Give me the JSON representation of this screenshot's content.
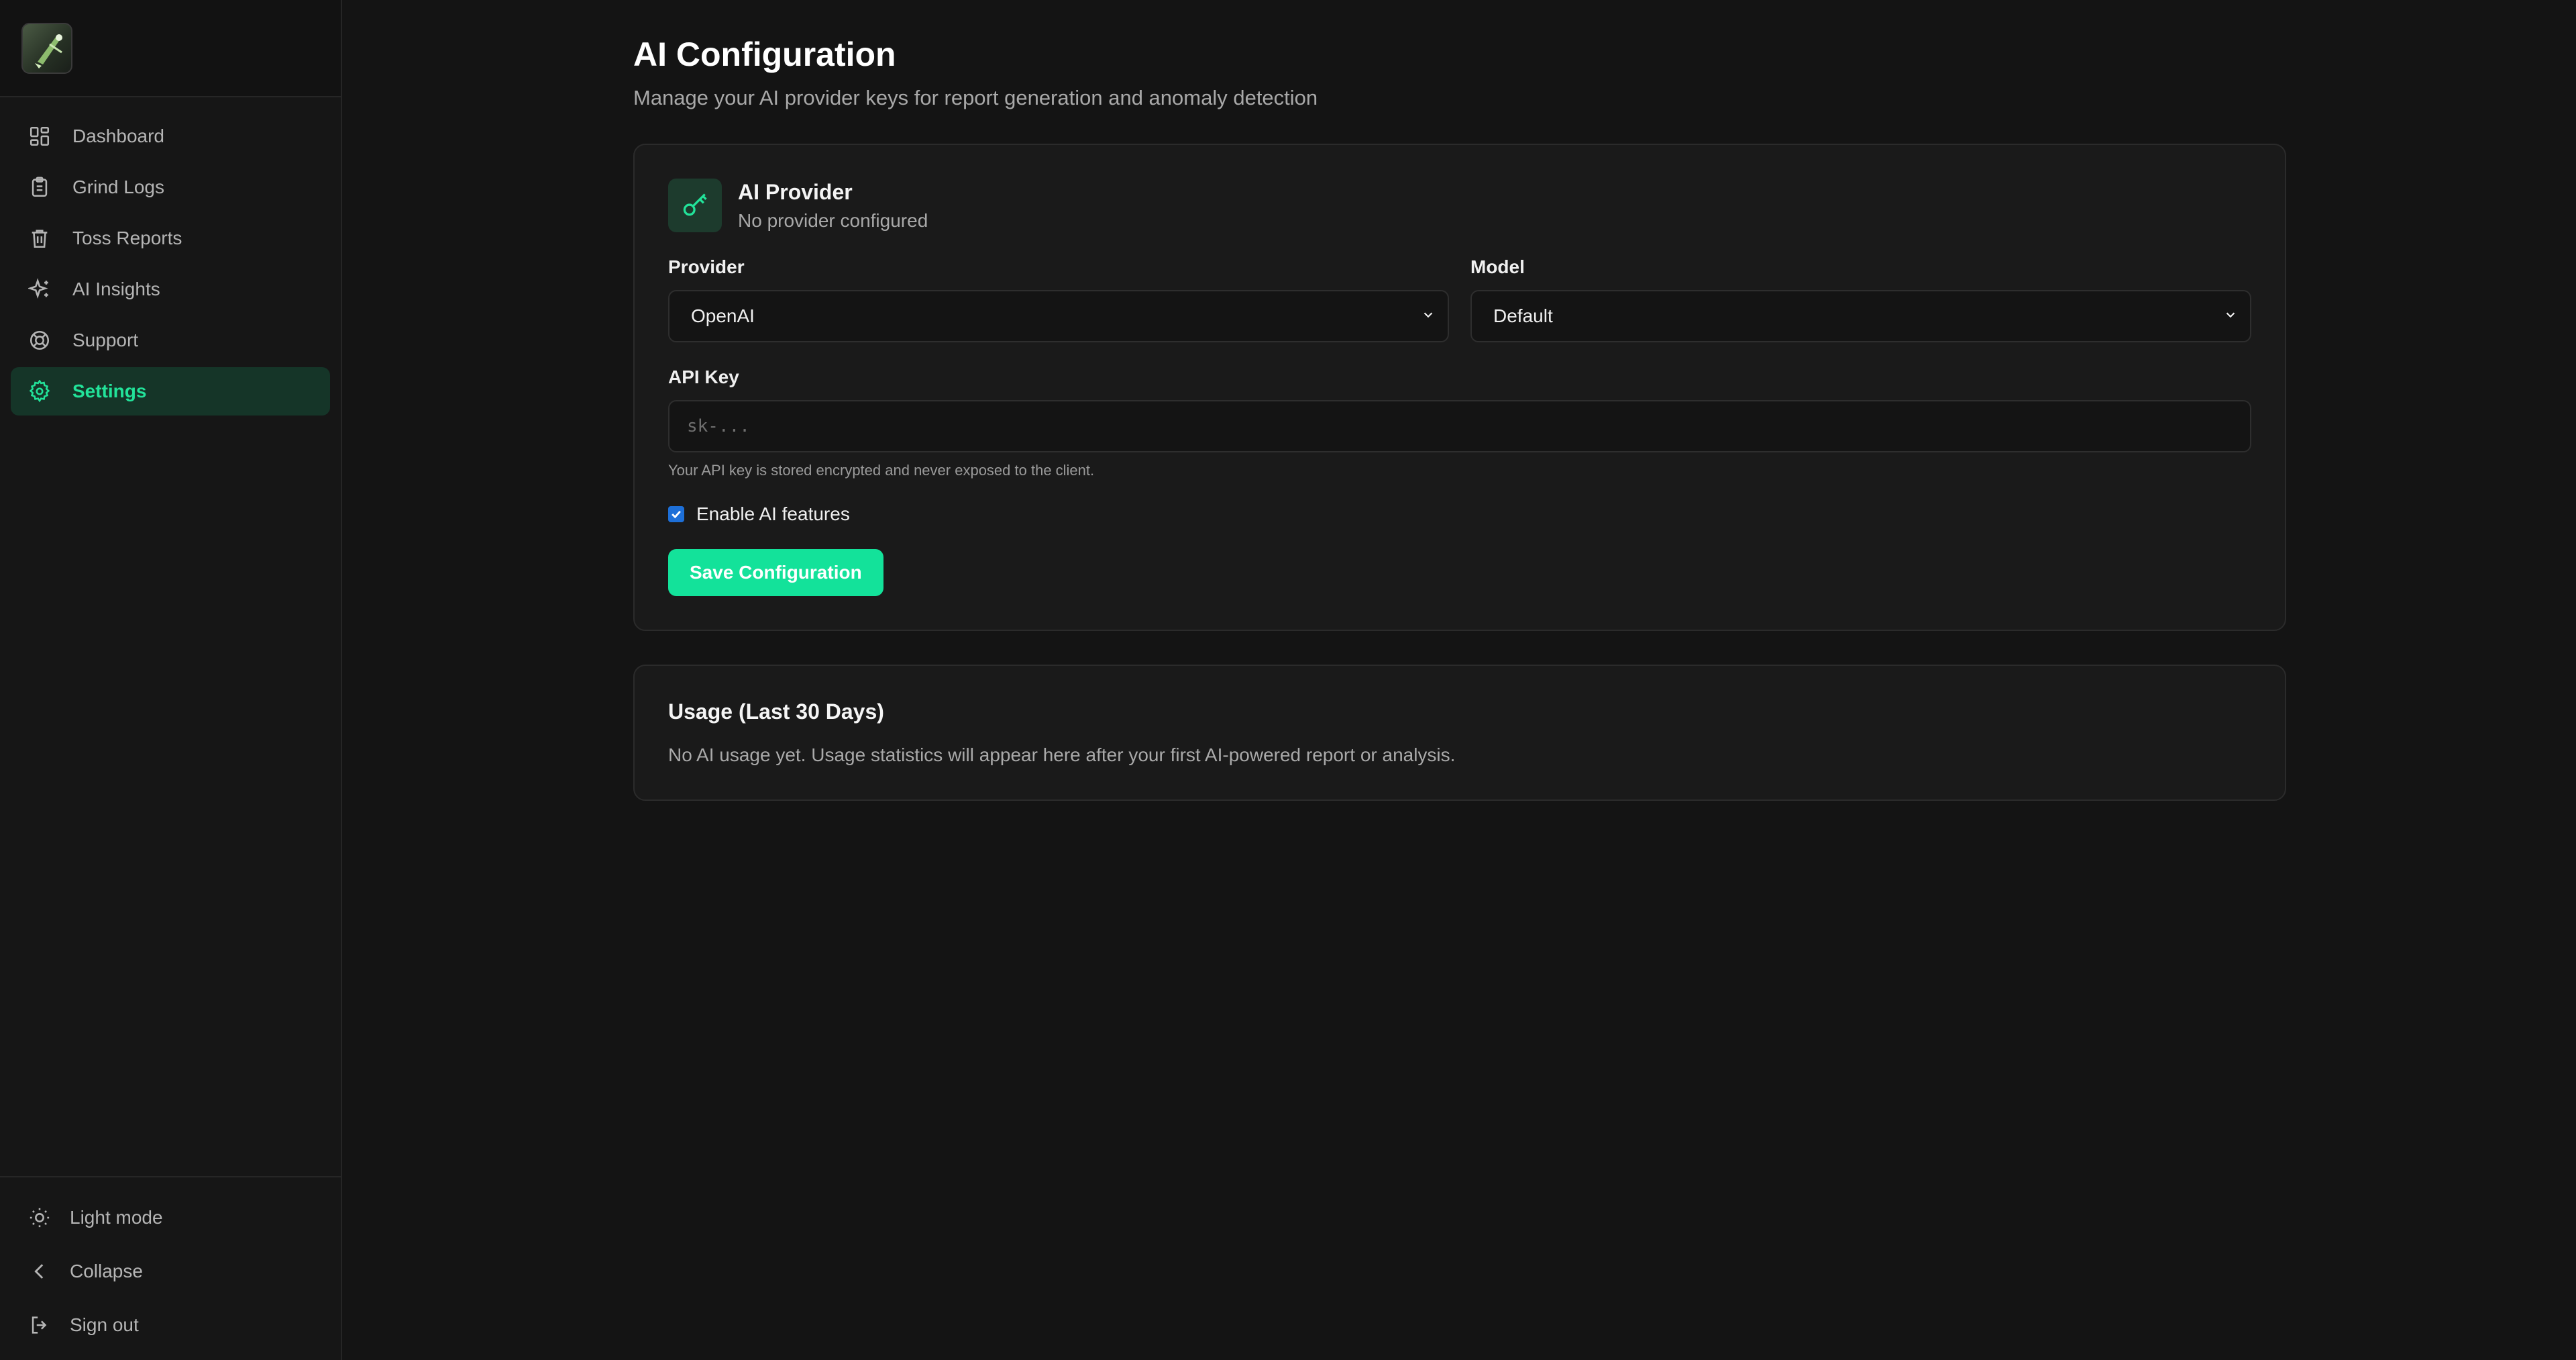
{
  "app": {
    "logo_icon": "app-logo-icon"
  },
  "sidebar": {
    "items": [
      {
        "label": "Dashboard",
        "icon": "dashboard-icon"
      },
      {
        "label": "Grind Logs",
        "icon": "clipboard-icon"
      },
      {
        "label": "Toss Reports",
        "icon": "trash-icon"
      },
      {
        "label": "AI Insights",
        "icon": "sparkles-icon"
      },
      {
        "label": "Support",
        "icon": "lifebuoy-icon"
      },
      {
        "label": "Settings",
        "icon": "gear-icon",
        "active": true
      }
    ],
    "footer": {
      "theme_label": "Light mode",
      "collapse_label": "Collapse",
      "signout_label": "Sign out"
    }
  },
  "page": {
    "title": "AI Configuration",
    "subtitle": "Manage your AI provider keys for report generation and anomaly detection"
  },
  "provider_card": {
    "title": "AI Provider",
    "status": "No provider configured",
    "provider_label": "Provider",
    "provider_value": "OpenAI",
    "model_label": "Model",
    "model_value": "Default",
    "api_key_label": "API Key",
    "api_key_placeholder": "sk-...",
    "api_key_hint": "Your API key is stored encrypted and never exposed to the client.",
    "enable_label": "Enable AI features",
    "enable_checked": true,
    "save_label": "Save Configuration"
  },
  "usage_card": {
    "title": "Usage (Last 30 Days)",
    "text": "No AI usage yet. Usage statistics will appear here after your first AI-powered report or analysis."
  },
  "colors": {
    "accent": "#13e29a",
    "accent_text": "#22e39a",
    "active_bg": "#153528",
    "background": "#141414",
    "card": "#1a1a1a"
  }
}
